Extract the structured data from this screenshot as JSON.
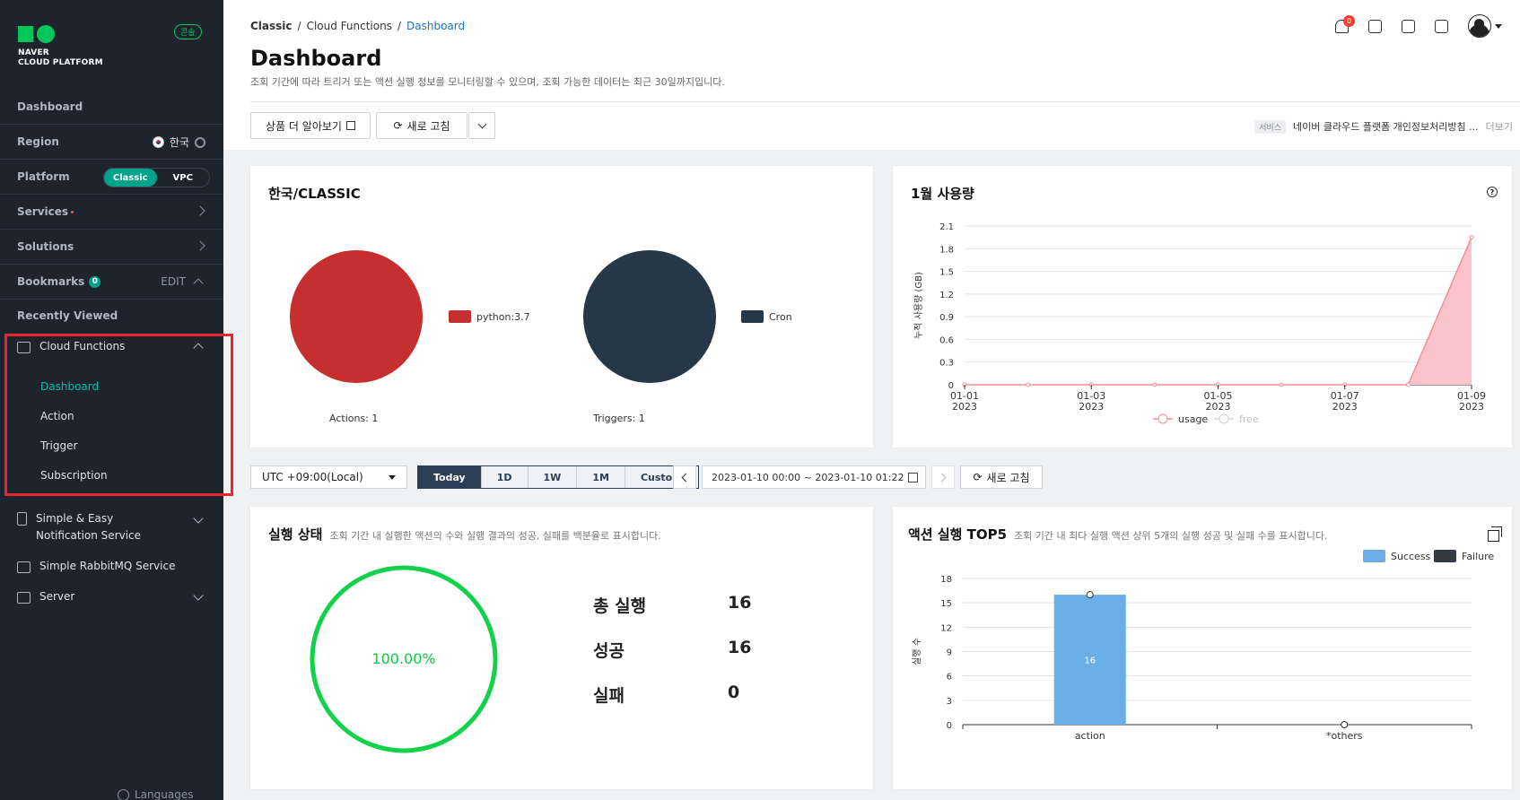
{
  "sidebar": {
    "logo_line1": "NAVER",
    "logo_line2": "CLOUD PLATFORM",
    "console_badge": "콘솔",
    "dashboard": "Dashboard",
    "region_label": "Region",
    "region_value": "한국",
    "platform_label": "Platform",
    "platform_options": [
      "Classic",
      "VPC"
    ],
    "platform_selected": "Classic",
    "services": "Services",
    "solutions": "Solutions",
    "bookmarks": "Bookmarks",
    "bookmarks_count": "0",
    "bookmarks_edit": "EDIT",
    "recently_viewed": "Recently Viewed",
    "cloud_functions": {
      "label": "Cloud Functions",
      "items": [
        "Dashboard",
        "Action",
        "Trigger",
        "Subscription"
      ],
      "active": "Dashboard"
    },
    "groups": [
      "Simple & Easy Notification Service",
      "Simple RabbitMQ Service",
      "Server"
    ],
    "languages": "Languages"
  },
  "header": {
    "breadcrumb": [
      "Classic",
      "Cloud Functions",
      "Dashboard"
    ],
    "title": "Dashboard",
    "description": "조회 기간에 따라 트리거 또는 액션 실행 정보를 모니터링할 수 있으며, 조회 가능한 데이터는 최근 30일까지입니다.",
    "notification_count": "0",
    "btn_learn_more": "상품 더 알아보기",
    "btn_refresh": "새로 고침",
    "notice_tag": "서비스",
    "notice_text": "네이버 클라우드 플랫폼 개인정보처리방침 ...",
    "notice_more": "더보기"
  },
  "region_card": {
    "title": "한국/CLASSIC",
    "actions_legend": "python:3.7",
    "actions_caption": "Actions: 1",
    "triggers_legend": "Cron",
    "triggers_caption": "Triggers: 1",
    "actions_color": "#c62f30",
    "triggers_color": "#263847"
  },
  "usage_card": {
    "title": "1월 사용량",
    "help": "?"
  },
  "filters": {
    "timezone": "UTC +09:00(Local)",
    "periods": [
      "Today",
      "1D",
      "1W",
      "1M",
      "Custom"
    ],
    "selected_period": "Today",
    "date_range": "2023-01-10 00:00 ~ 2023-01-10 01:22",
    "refresh": "새로 고침"
  },
  "exec_card": {
    "title": "실행 상태",
    "subtitle": "조회 기간 내 실행한 액션의 수와 실행 결과의 성공, 실패를 백분율로 표시합니다.",
    "percent": "100.00%",
    "stats": [
      {
        "label": "총 실행",
        "value": "16"
      },
      {
        "label": "성공",
        "value": "16"
      },
      {
        "label": "실패",
        "value": "0"
      }
    ]
  },
  "top5_card": {
    "title": "액션 실행 TOP5",
    "subtitle": "조회 기간 내 최다 실행 액션 상위 5개의 실행 성공 및 실패 수를 표시합니다.",
    "legend": [
      "Success",
      "Failure"
    ],
    "legend_colors": [
      "#6aaee8",
      "#333a44"
    ]
  },
  "chart_data": [
    {
      "type": "area",
      "title": "1월 사용량",
      "ylabel": "누적 사용량 (GB)",
      "x": [
        "2023-01-01",
        "2023-01-02",
        "2023-01-03",
        "2023-01-04",
        "2023-01-05",
        "2023-01-06",
        "2023-01-07",
        "2023-01-08",
        "2023-01-09"
      ],
      "xticks": [
        "01-01|2023",
        "01-03|2023",
        "01-05|2023",
        "01-07|2023",
        "01-09|2023"
      ],
      "yticks": [
        "0",
        "0.3",
        "0.6",
        "0.9",
        "1.2",
        "1.5",
        "1.8",
        "2.1"
      ],
      "ylim": [
        0,
        2.1
      ],
      "series": [
        {
          "name": "usage",
          "values": [
            0,
            0,
            0,
            0,
            0,
            0,
            0,
            0,
            1.95
          ],
          "color": "#f58b98"
        },
        {
          "name": "free",
          "values": [],
          "color": "#cfd3d9"
        }
      ],
      "grid": true,
      "legend": "bottom"
    },
    {
      "type": "bar",
      "title": "액션 실행 TOP5",
      "ylabel": "실행 수",
      "categories": [
        "action",
        "*others"
      ],
      "series": [
        {
          "name": "Success",
          "values": [
            16,
            0
          ],
          "color": "#6aaee8"
        },
        {
          "name": "Failure",
          "values": [
            0,
            0
          ],
          "color": "#333a44"
        }
      ],
      "yticks": [
        "0",
        "3",
        "6",
        "9",
        "12",
        "15",
        "18"
      ],
      "ylim": [
        0,
        18
      ],
      "data_labels": [
        "16"
      ],
      "legend": "top-right"
    }
  ]
}
